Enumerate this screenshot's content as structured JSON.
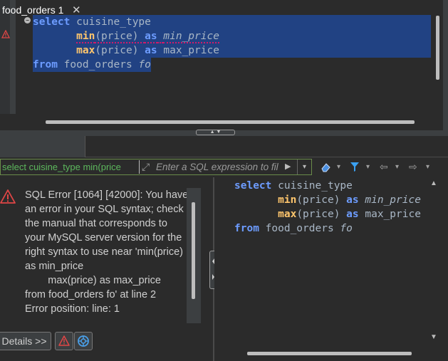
{
  "editor": {
    "lines": [
      [
        {
          "t": "select",
          "c": "kwb"
        },
        {
          "t": " cuisine_type",
          "c": "id"
        }
      ],
      [
        {
          "t": "       ",
          "c": "id"
        },
        {
          "t": "min",
          "c": "fn"
        },
        {
          "t": "(price) ",
          "c": "id"
        },
        {
          "t": "as",
          "c": "kwb"
        },
        {
          "t": " ",
          "c": "id"
        },
        {
          "t": "min_price",
          "c": "id ital"
        }
      ],
      [
        {
          "t": "       ",
          "c": "id"
        },
        {
          "t": "max",
          "c": "fn"
        },
        {
          "t": "(price) ",
          "c": "id"
        },
        {
          "t": "as",
          "c": "kwb"
        },
        {
          "t": " max_price",
          "c": "id"
        }
      ],
      [
        {
          "t": "from",
          "c": "kwb"
        },
        {
          "t": " food_orders ",
          "c": "id"
        },
        {
          "t": "fo",
          "c": "id ital"
        }
      ]
    ],
    "fold_glyph": "−",
    "warning_icon": "warning-triangle-icon"
  },
  "splitter": {
    "handle_glyph": "▲ ▼"
  },
  "results_tab": {
    "label": "food_orders 1",
    "close_glyph": "✕"
  },
  "filter": {
    "value": "select cuisine_type min(price",
    "placeholder": "Enter a SQL expression to fil",
    "expand_glyph": "⤢",
    "run_glyph": "▶",
    "dropdown_glyph": "▾"
  },
  "toolbar": {
    "eraser_glyph": "⌫",
    "filter_glyph": "▼",
    "back_glyph": "⇦",
    "forward_glyph": "⇨",
    "more_glyph": "▾"
  },
  "error": {
    "message": "SQL Error [1064] [42000]: You have an error in your SQL syntax; check the manual that corresponds to your MySQL server version for the right syntax to use near 'min(price) as min_price\n        max(price) as max_price\nfrom food_orders fo' at line 2\nError position: line: 1",
    "details_label": "Details >>",
    "icon": "error-triangle-icon"
  },
  "query_view": {
    "lines": [
      [
        {
          "t": "select",
          "c": "kwb"
        },
        {
          "t": " cuisine_type",
          "c": "id"
        }
      ],
      [
        {
          "t": "       ",
          "c": "id"
        },
        {
          "t": "min",
          "c": "fn"
        },
        {
          "t": "(price) ",
          "c": "id"
        },
        {
          "t": "as",
          "c": "kwb"
        },
        {
          "t": " ",
          "c": "id"
        },
        {
          "t": "min_price",
          "c": "id ital"
        }
      ],
      [
        {
          "t": "       ",
          "c": "id"
        },
        {
          "t": "max",
          "c": "fn"
        },
        {
          "t": "(price) ",
          "c": "id"
        },
        {
          "t": "as",
          "c": "kwb"
        },
        {
          "t": " max_price",
          "c": "id"
        }
      ],
      [
        {
          "t": "from",
          "c": "kwb"
        },
        {
          "t": " food_orders ",
          "c": "id"
        },
        {
          "t": "fo",
          "c": "id ital"
        }
      ]
    ]
  },
  "colors": {
    "selection": "#214283",
    "keyword": "#6d9cff",
    "function": "#ffc66d",
    "error_red": "#e04646",
    "filter_green": "#5db85d"
  }
}
